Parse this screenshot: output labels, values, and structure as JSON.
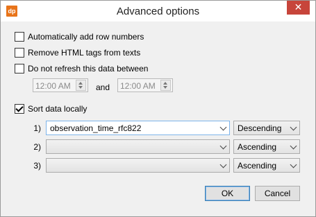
{
  "window": {
    "title": "Advanced options",
    "app_icon_text": "dp",
    "close_glyph": "✕"
  },
  "options": {
    "auto_row_numbers": {
      "label": "Automatically add row numbers",
      "checked": false
    },
    "remove_html": {
      "label": "Remove HTML tags from texts",
      "checked": false
    },
    "no_refresh": {
      "label": "Do not refresh this data between",
      "checked": false
    },
    "sort_locally": {
      "label": "Sort data locally",
      "checked": true
    }
  },
  "refresh_window": {
    "from_time": "12:00 AM",
    "and_label": "and",
    "to_time": "12:00 AM"
  },
  "sort_rows": [
    {
      "index": "1)",
      "field": "observation_time_rfc822",
      "order": "Descending"
    },
    {
      "index": "2)",
      "field": "",
      "order": "Ascending"
    },
    {
      "index": "3)",
      "field": "",
      "order": "Ascending"
    }
  ],
  "buttons": {
    "ok": "OK",
    "cancel": "Cancel"
  }
}
